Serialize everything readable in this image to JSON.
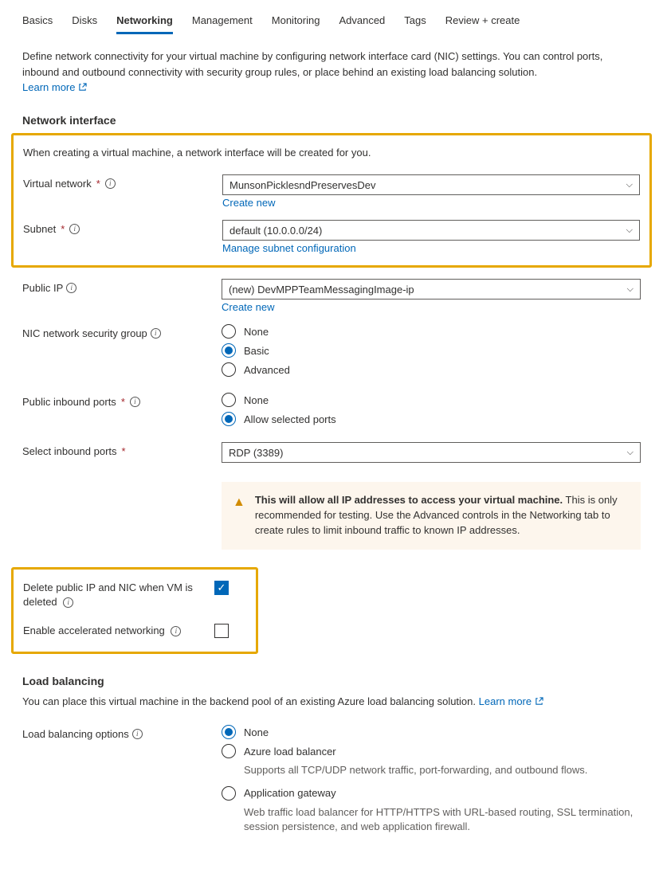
{
  "tabs": {
    "basics": "Basics",
    "disks": "Disks",
    "networking": "Networking",
    "management": "Management",
    "monitoring": "Monitoring",
    "advanced": "Advanced",
    "tags": "Tags",
    "review": "Review + create"
  },
  "intro": {
    "text": "Define network connectivity for your virtual machine by configuring network interface card (NIC) settings. You can control ports, inbound and outbound connectivity with security group rules, or place behind an existing load balancing solution.",
    "learn_more": "Learn more"
  },
  "section_ni": {
    "title": "Network interface",
    "note": "When creating a virtual machine, a network interface will be created for you.",
    "vnet": {
      "label": "Virtual network",
      "value": "MunsonPicklesndPreservesDev",
      "create": "Create new"
    },
    "subnet": {
      "label": "Subnet",
      "value": "default (10.0.0.0/24)",
      "manage": "Manage subnet configuration"
    },
    "pip": {
      "label": "Public IP",
      "value": "(new) DevMPPTeamMessagingImage-ip",
      "create": "Create new"
    },
    "nsg": {
      "label": "NIC network security group",
      "options": {
        "none": "None",
        "basic": "Basic",
        "advanced": "Advanced"
      }
    },
    "inbound": {
      "label": "Public inbound ports",
      "options": {
        "none": "None",
        "allow": "Allow selected ports"
      }
    },
    "select_ports": {
      "label": "Select inbound ports",
      "value": "RDP (3389)"
    },
    "warn": {
      "bold": "This will allow all IP addresses to access your virtual machine.",
      "rest": "This is only recommended for testing.  Use the Advanced controls in the Networking tab to create rules to limit inbound traffic to known IP addresses."
    },
    "delete_label": "Delete public IP and NIC when VM is deleted",
    "accel_label": "Enable accelerated networking"
  },
  "section_lb": {
    "title": "Load balancing",
    "text": "You can place this virtual machine in the backend pool of an existing Azure load balancing solution.",
    "learn_more": "Learn more",
    "options_label": "Load balancing options",
    "none": {
      "label": "None"
    },
    "alb": {
      "label": "Azure load balancer",
      "desc": "Supports all TCP/UDP network traffic, port-forwarding, and outbound flows."
    },
    "agw": {
      "label": "Application gateway",
      "desc": "Web traffic load balancer for HTTP/HTTPS with URL-based routing, SSL termination, session persistence, and web application firewall."
    }
  }
}
